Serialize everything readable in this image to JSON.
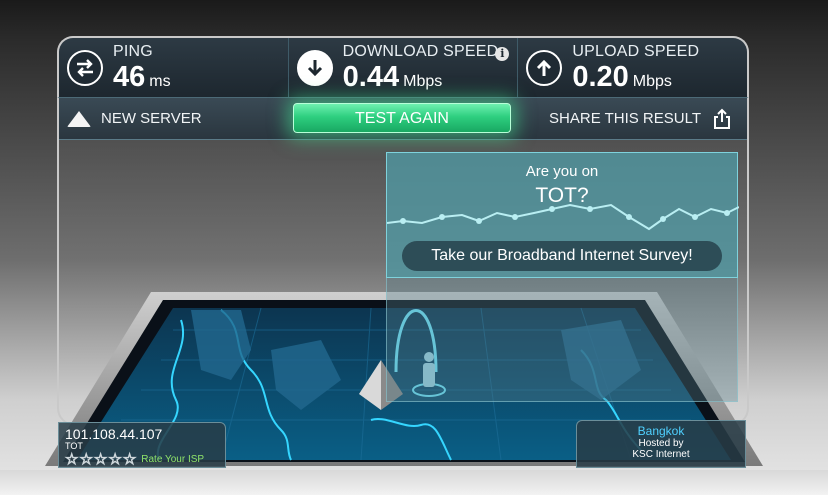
{
  "metrics": {
    "ping": {
      "label": "PING",
      "value": "46",
      "unit": "ms",
      "icon": "ping-arrows-icon"
    },
    "download": {
      "label": "DOWNLOAD SPEED",
      "value": "0.44",
      "unit": "Mbps",
      "icon": "download-arrow-icon",
      "info": "i"
    },
    "upload": {
      "label": "UPLOAD SPEED",
      "value": "0.20",
      "unit": "Mbps",
      "icon": "upload-arrow-icon"
    }
  },
  "actions": {
    "new_server": "NEW SERVER",
    "test_again": "TEST AGAIN",
    "share": "SHARE THIS RESULT"
  },
  "survey": {
    "question": "Are you on",
    "isp": "TOT?",
    "button": "Take our Broadband Internet Survey!"
  },
  "client": {
    "ip": "101.108.44.107",
    "isp": "TOT",
    "rate_label": "Rate Your ISP",
    "stars": [
      "☆",
      "☆",
      "☆",
      "☆",
      "☆"
    ]
  },
  "server": {
    "city": "Bangkok",
    "hosted_by": "Hosted by",
    "host": "KSC Internet"
  },
  "colors": {
    "accent_green": "#2ecf80",
    "map_blue": "#1a9fd6",
    "city_blue": "#4fd0ff"
  }
}
